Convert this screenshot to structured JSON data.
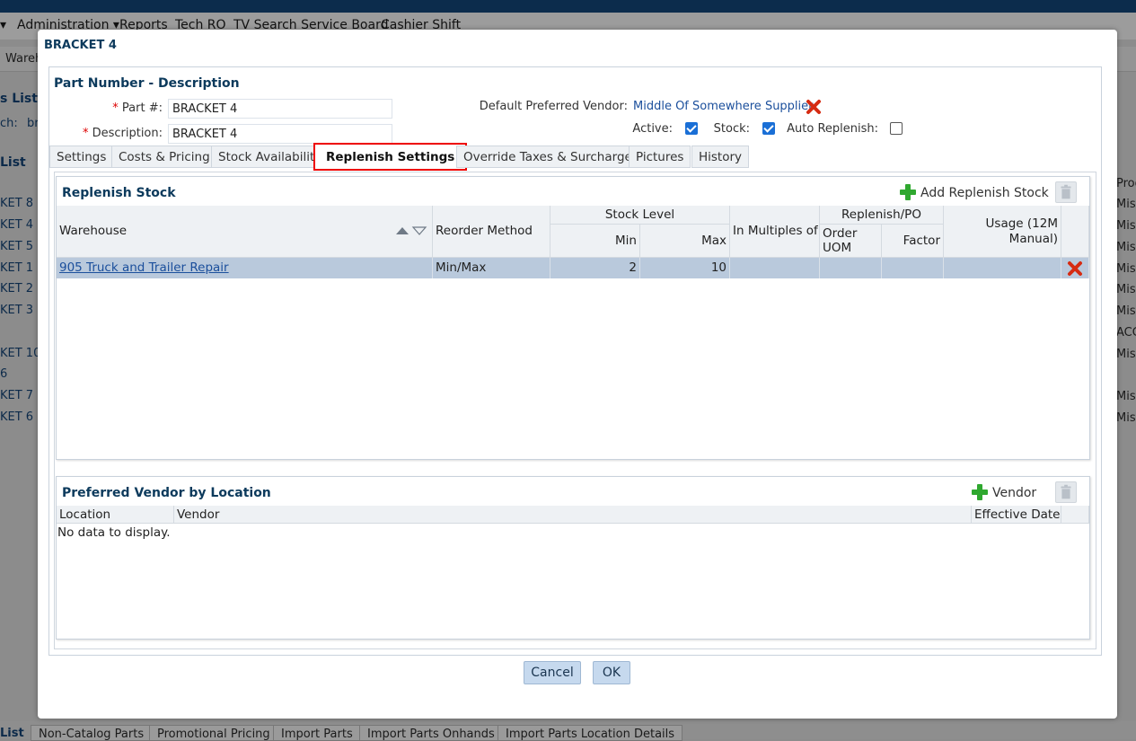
{
  "background": {
    "menu": [
      "Administration",
      "Reports",
      "Tech RO",
      "TV Search Service Board",
      "Cashier Shift"
    ],
    "subbar_text": "Wareh",
    "left_title": "s List",
    "left_search": "ch:",
    "left_search_value": "br",
    "left_list_title": "List",
    "left_rows": [
      "KET 8",
      "KET 4",
      "KET 5",
      "KET 1",
      "KET 2",
      "KET 3",
      "KET 10",
      "6",
      "KET 7",
      "KET 6"
    ],
    "right_header": "Prod",
    "right_rows": [
      "Misc",
      "Misc",
      "Misc",
      "Misc",
      "Misc",
      "Misc",
      "ACC",
      "Misc",
      "Misc",
      "Misc"
    ],
    "bottom_tabs": [
      "List",
      "Non-Catalog Parts",
      "Promotional Pricing",
      "Import Parts",
      "Import Parts Onhands",
      "Import Parts Location Details"
    ]
  },
  "modal": {
    "title": "BRACKET 4",
    "section_title": "Part Number - Description",
    "part_label": "Part #:",
    "part_value": "BRACKET 4",
    "desc_label": "Description:",
    "desc_value": "BRACKET 4",
    "vendor_label": "Default Preferred Vendor:",
    "vendor_value": "Middle Of Somewhere Supplier",
    "active_label": "Active:",
    "stock_label": "Stock:",
    "auto_label": "Auto Replenish:",
    "tabs": [
      "Settings",
      "Costs & Pricing",
      "Stock Availability",
      "Replenish Settings",
      "Override Taxes & Surcharges",
      "Pictures",
      "History"
    ],
    "replenish": {
      "title": "Replenish Stock",
      "add_label": "Add Replenish Stock",
      "headers": {
        "warehouse": "Warehouse",
        "reorder": "Reorder Method",
        "stock_level": "Stock Level",
        "min": "Min",
        "max": "Max",
        "multiples": "In Multiples of",
        "replenish_po": "Replenish/PO",
        "order_uom": "Order UOM",
        "factor": "Factor",
        "usage": "Usage (12M Manual)"
      },
      "rows": [
        {
          "warehouse": "905 Truck and Trailer Repair",
          "reorder": "Min/Max",
          "min": "2",
          "max": "10",
          "multiples": "",
          "order_uom": "",
          "factor": "",
          "usage": ""
        }
      ]
    },
    "vendor_loc": {
      "title": "Preferred Vendor by Location",
      "add_label": "Vendor",
      "headers": {
        "location": "Location",
        "vendor": "Vendor",
        "effective": "Effective Date"
      },
      "empty": "No data to display."
    },
    "cancel_label": "Cancel",
    "ok_label": "OK"
  }
}
